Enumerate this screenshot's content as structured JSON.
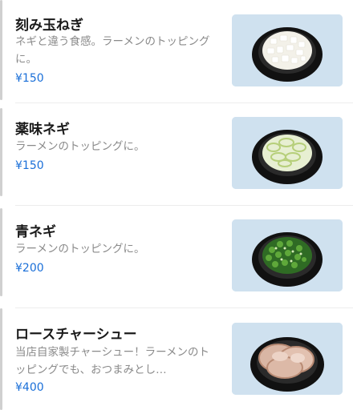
{
  "menu": {
    "items": [
      {
        "name": "刻み玉ねぎ",
        "desc": "ネギと違う食感。ラーメンのトッピングに。",
        "price": "¥150",
        "image": "chopped-onion"
      },
      {
        "name": "薬味ネギ",
        "desc": "ラーメンのトッピングに。",
        "price": "¥150",
        "image": "sliced-white-leek"
      },
      {
        "name": "青ネギ",
        "desc": "ラーメンのトッピングに。",
        "price": "¥200",
        "image": "chopped-green-onion"
      },
      {
        "name": "ロースチャーシュー",
        "desc": "当店自家製チャーシュー！ラーメンのトッピングでも、おつまみとし…",
        "price": "¥400",
        "image": "sliced-roast-pork"
      }
    ]
  },
  "colors": {
    "price": "#1a6fd8",
    "background": "#ffffff",
    "thumb_bg": "#cfe1ef"
  }
}
